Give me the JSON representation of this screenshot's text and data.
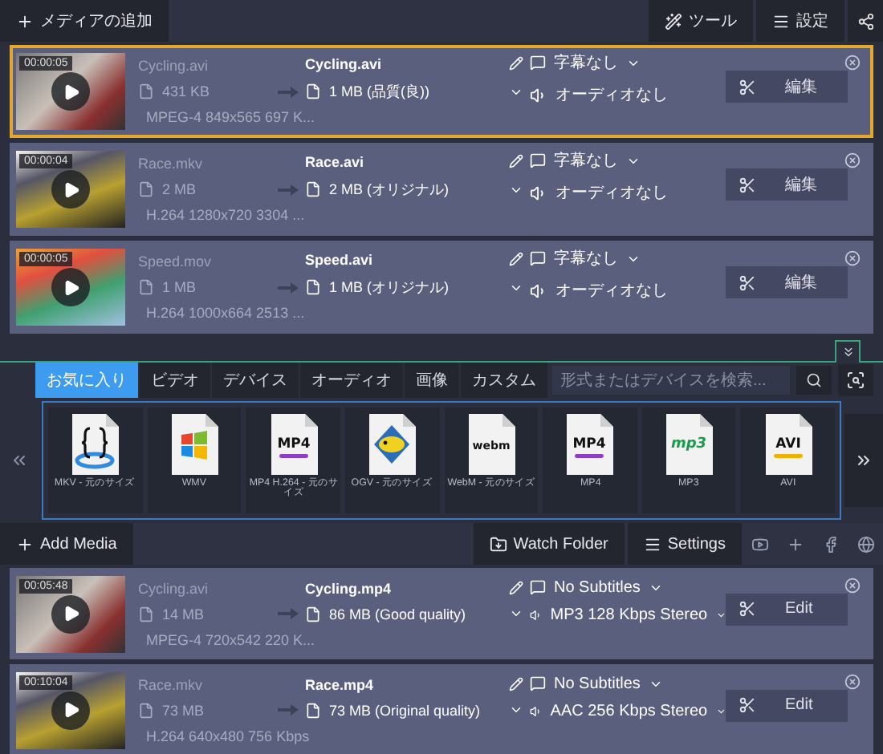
{
  "top": {
    "toolbar": {
      "add_button": "メディアの追加",
      "tools_button": "ツール",
      "settings_button": "設定"
    },
    "files": [
      {
        "duration": "00:00:05",
        "source_name": "Cycling.avi",
        "source_size": "431 KB",
        "source_info": "MPEG-4 849x565 697 K...",
        "output_name": "Cycling.avi",
        "output_size": "1 MB (品質(良))",
        "subtitles": "字幕なし",
        "audio": "オーディオなし",
        "audio_dropdown": false,
        "edit_label": "編集",
        "selected": true
      },
      {
        "duration": "00:00:04",
        "source_name": "Race.mkv",
        "source_size": "2 MB",
        "source_info": "H.264 1280x720 3304 ...",
        "output_name": "Race.avi",
        "output_size": "2 MB (オリジナル)",
        "subtitles": "字幕なし",
        "audio": "オーディオなし",
        "audio_dropdown": false,
        "edit_label": "編集",
        "selected": false
      },
      {
        "duration": "00:00:05",
        "source_name": "Speed.mov",
        "source_size": "1 MB",
        "source_info": "H.264 1000x664 2513 ...",
        "output_name": "Speed.avi",
        "output_size": "1 MB (オリジナル)",
        "subtitles": "字幕なし",
        "audio": "オーディオなし",
        "audio_dropdown": false,
        "edit_label": "編集",
        "selected": false
      }
    ]
  },
  "format_panel": {
    "tabs": [
      {
        "label": "お気に入り",
        "selected": true
      },
      {
        "label": "ビデオ",
        "selected": false
      },
      {
        "label": "デバイス",
        "selected": false
      },
      {
        "label": "オーディオ",
        "selected": false
      },
      {
        "label": "画像",
        "selected": false
      },
      {
        "label": "カスタム",
        "selected": false
      }
    ],
    "search": {
      "placeholder": "形式またはデバイスを検索..."
    },
    "formats": [
      {
        "kind": "mkv",
        "label": "MKV - 元のサイズ"
      },
      {
        "kind": "wmv",
        "label": "WMV"
      },
      {
        "kind": "mp4",
        "logo_text": "MP4",
        "label": "MP4 H.264 - 元のサイズ"
      },
      {
        "kind": "ogv",
        "label": "OGV - 元のサイズ"
      },
      {
        "kind": "webm",
        "logo_text": "webm",
        "label": "WebM - 元のサイズ"
      },
      {
        "kind": "mp4",
        "logo_text": "MP4",
        "label": "MP4"
      },
      {
        "kind": "mp3",
        "logo_text": "mp3",
        "label": "MP3"
      },
      {
        "kind": "avi",
        "logo_text": "AVI",
        "label": "AVI"
      }
    ]
  },
  "bottom": {
    "toolbar": {
      "add_button": "Add Media",
      "watch_folder_button": "Watch Folder",
      "settings_button": "Settings"
    },
    "files": [
      {
        "duration": "00:05:48",
        "source_name": "Cycling.avi",
        "source_size": "14 MB",
        "source_info": "MPEG-4 720x542 220 K...",
        "output_name": "Cycling.mp4",
        "output_size": "86 MB (Good quality)",
        "subtitles": "No Subtitles",
        "audio": "MP3 128 Kbps Stereo",
        "audio_dropdown": true,
        "edit_label": "Edit",
        "selected": false
      },
      {
        "duration": "00:10:04",
        "source_name": "Race.mkv",
        "source_size": "73 MB",
        "source_info": "H.264 640x480 756 Kbps",
        "output_name": "Race.mp4",
        "output_size": "73 MB (Original quality)",
        "subtitles": "No Subtitles",
        "audio": "AAC 256 Kbps Stereo",
        "audio_dropdown": true,
        "edit_label": "Edit",
        "selected": false
      }
    ]
  }
}
